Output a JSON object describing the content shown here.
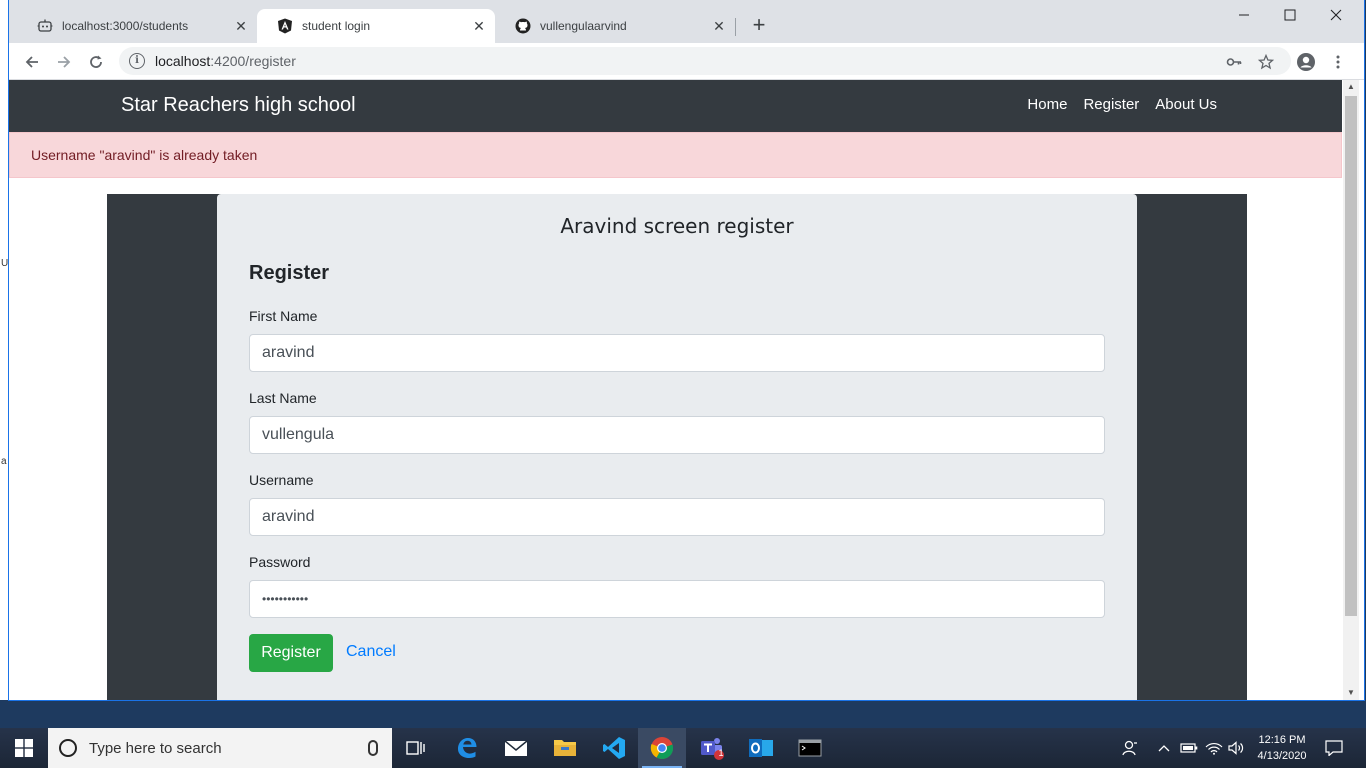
{
  "desktop": {
    "left_chars": [
      "U",
      "a"
    ]
  },
  "browser": {
    "tabs": [
      {
        "title": "localhost:3000/students",
        "icon": "robot-icon",
        "active": false
      },
      {
        "title": "student login",
        "icon": "angular-icon",
        "active": true
      },
      {
        "title": "vullengulaarvind",
        "icon": "github-icon",
        "active": false
      }
    ],
    "new_tab_symbol": "+",
    "url_host": "localhost",
    "url_path": ":4200/register"
  },
  "site": {
    "brand": "Star Reachers high school",
    "nav": [
      "Home",
      "Register",
      "About Us"
    ],
    "alert": "Username \"aravind\" is already taken",
    "card_header": "Aravind screen register",
    "form_title": "Register",
    "fields": {
      "first_name": {
        "label": "First Name",
        "value": "aravind"
      },
      "last_name": {
        "label": "Last Name",
        "value": "vullengula"
      },
      "username": {
        "label": "Username",
        "value": "aravind"
      },
      "password": {
        "label": "Password",
        "value": "•••••••••••"
      }
    },
    "register_button": "Register",
    "cancel_link": "Cancel"
  },
  "taskbar": {
    "search_placeholder": "Type here to search",
    "time": "12:16 PM",
    "date": "4/13/2020",
    "teams_badge": "1"
  },
  "colors": {
    "navbar": "#343a40",
    "alert_bg": "#f8d7da",
    "alert_text": "#721c24",
    "card_bg": "#e9ecef",
    "success": "#28a745",
    "link": "#007bff"
  }
}
